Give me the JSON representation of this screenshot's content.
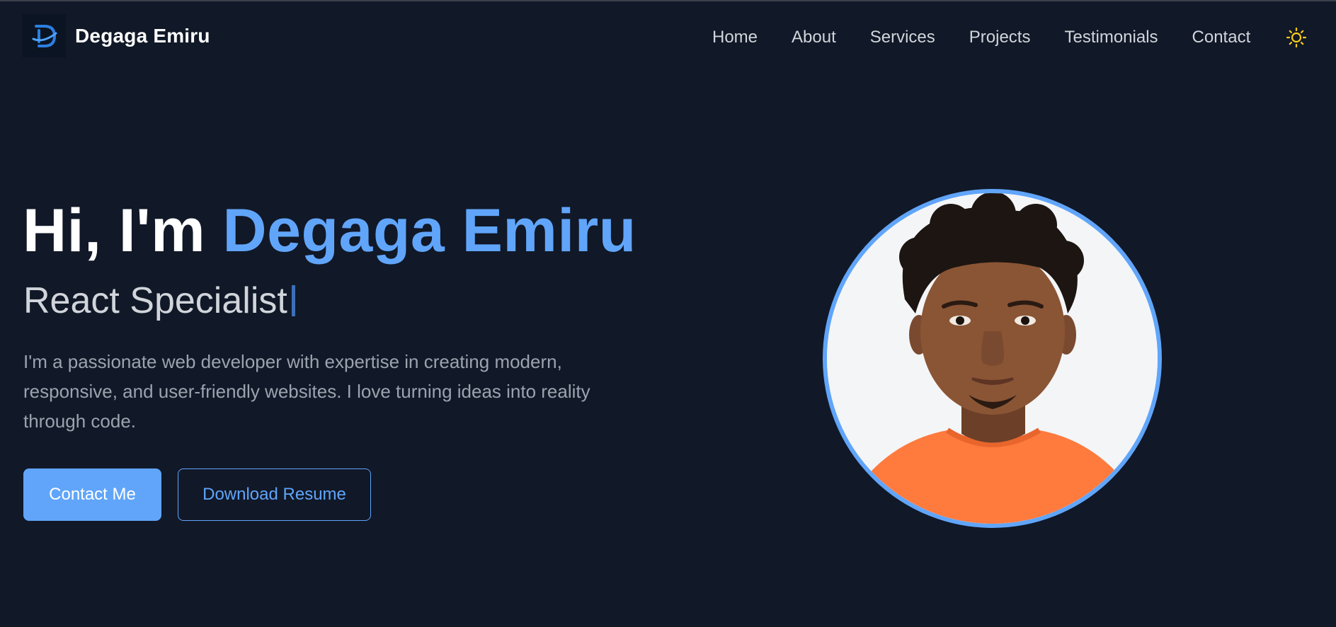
{
  "brand": {
    "name": "Degaga Emiru",
    "logo_icon": "d-letter-logo-icon"
  },
  "nav": {
    "items": [
      {
        "label": "Home"
      },
      {
        "label": "About"
      },
      {
        "label": "Services"
      },
      {
        "label": "Projects"
      },
      {
        "label": "Testimonials"
      },
      {
        "label": "Contact"
      }
    ],
    "theme_toggle_icon": "sun-icon"
  },
  "hero": {
    "greeting": "Hi, I'm",
    "name": "Degaga Emiru",
    "role": "React Specialist",
    "description": "I'm a passionate web developer with expertise in creating modern, responsive, and user-friendly websites. I love turning ideas into reality through code.",
    "primary_button": "Contact Me",
    "secondary_button": "Download Resume",
    "photo_icon": "profile-photo"
  },
  "colors": {
    "background": "#111827",
    "accent": "#60a5fa",
    "sun": "#facc15",
    "shirt": "#ff7a3d"
  }
}
